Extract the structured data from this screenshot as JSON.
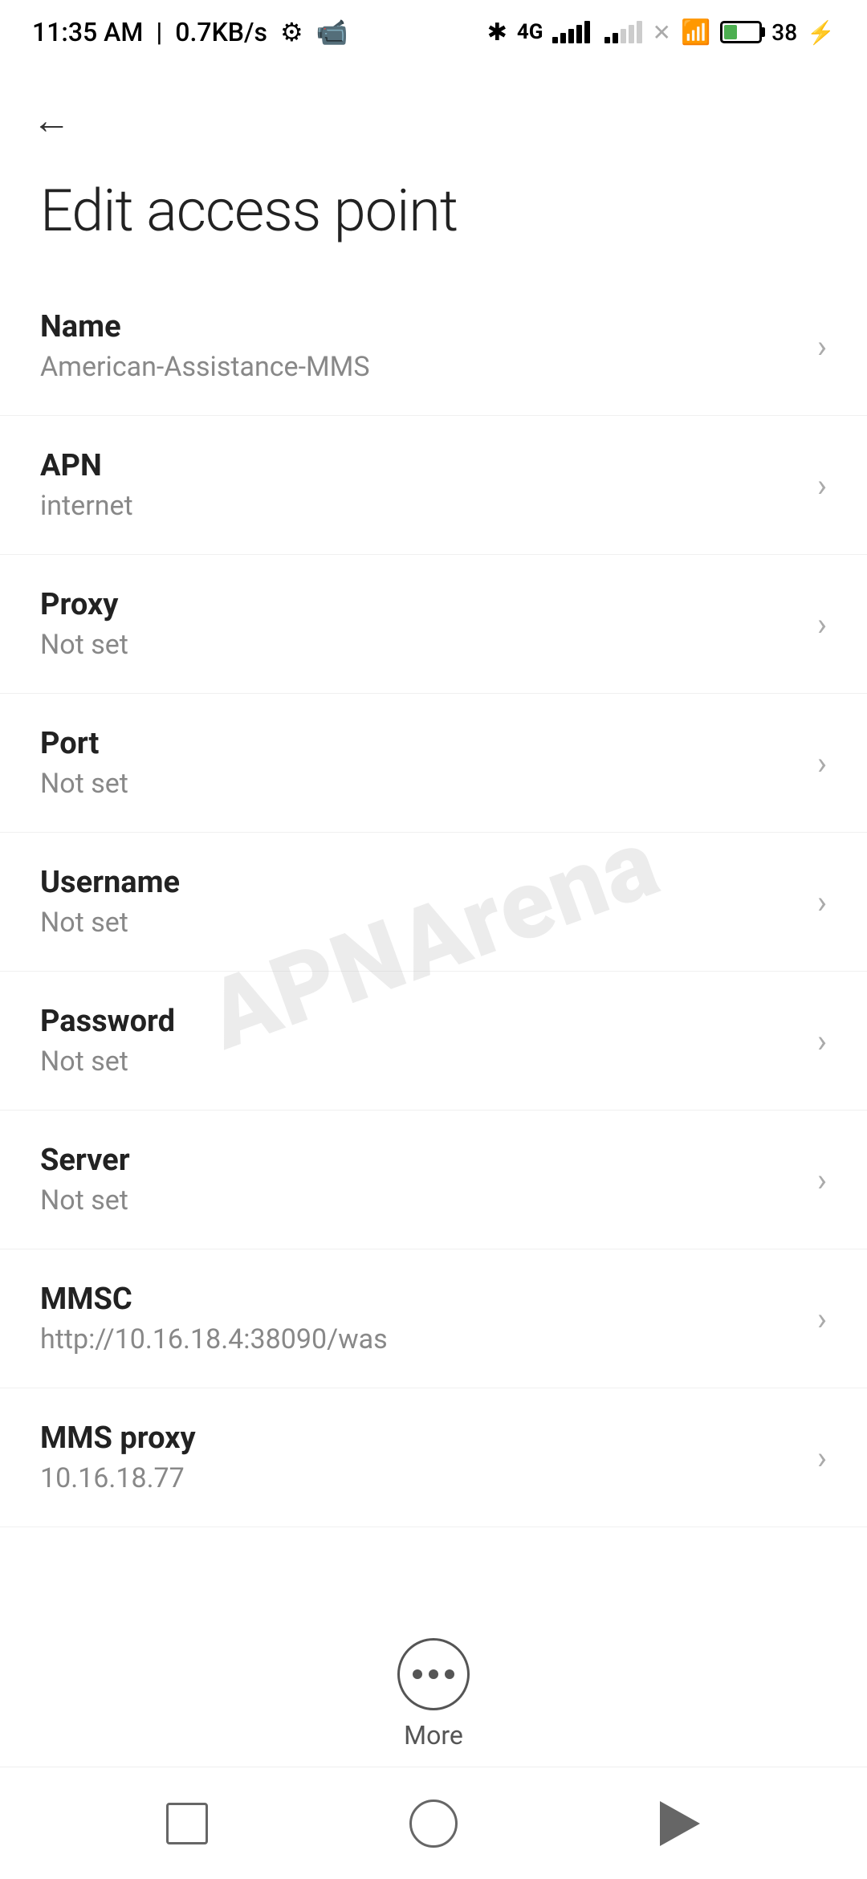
{
  "statusBar": {
    "time": "11:35 AM",
    "speed": "0.7KB/s",
    "batteryPercent": "38"
  },
  "header": {
    "backLabel": "←",
    "title": "Edit access point"
  },
  "watermark": {
    "text": "APNArena"
  },
  "settings": {
    "items": [
      {
        "label": "Name",
        "value": "American-Assistance-MMS"
      },
      {
        "label": "APN",
        "value": "internet"
      },
      {
        "label": "Proxy",
        "value": "Not set"
      },
      {
        "label": "Port",
        "value": "Not set"
      },
      {
        "label": "Username",
        "value": "Not set"
      },
      {
        "label": "Password",
        "value": "Not set"
      },
      {
        "label": "Server",
        "value": "Not set"
      },
      {
        "label": "MMSC",
        "value": "http://10.16.18.4:38090/was"
      },
      {
        "label": "MMS proxy",
        "value": "10.16.18.77"
      }
    ]
  },
  "bottomMore": {
    "label": "More"
  },
  "bottomNav": {
    "square": "recent-apps",
    "circle": "home",
    "triangle": "back"
  }
}
